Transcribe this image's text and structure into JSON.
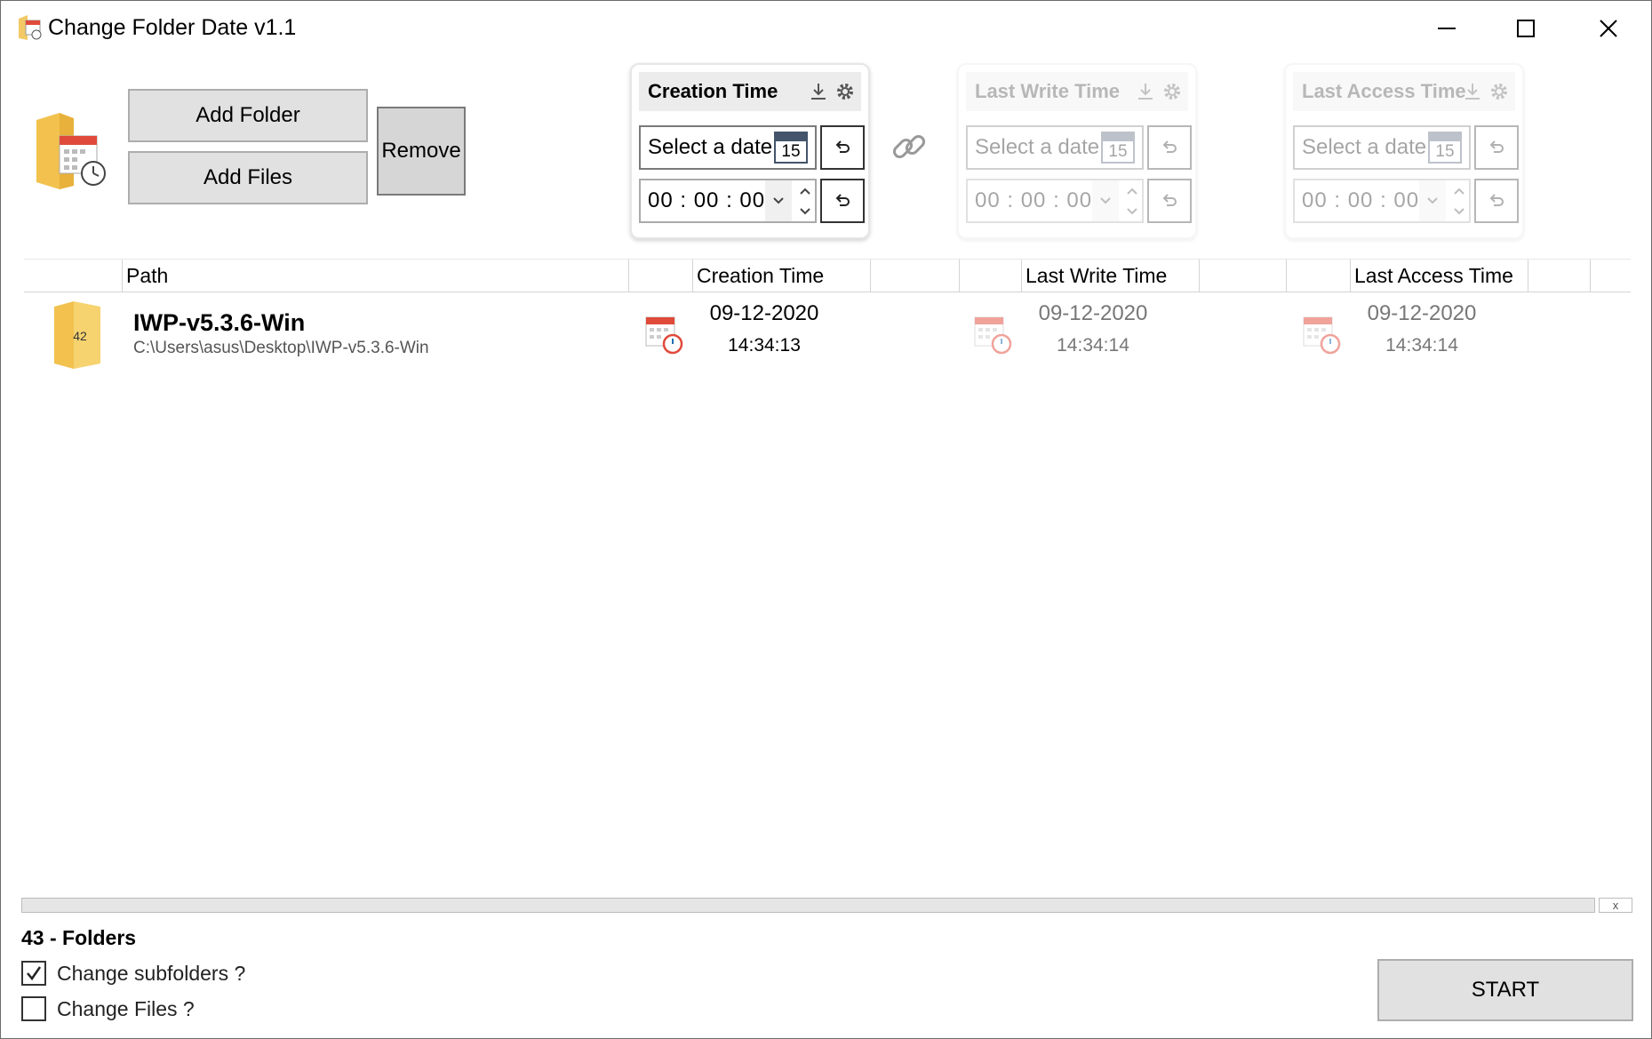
{
  "window": {
    "title": "Change Folder Date v1.1",
    "controls": [
      "minimize",
      "maximize",
      "close"
    ]
  },
  "toolbar": {
    "add_folder": "Add Folder",
    "add_files": "Add Files",
    "remove": "Remove"
  },
  "panels": [
    {
      "title": "Creation Time",
      "date_placeholder": "Select a date",
      "calendar_day": "15",
      "time": "00 : 00 : 00",
      "enabled": true
    },
    {
      "title": "Last Write Time",
      "date_placeholder": "Select a date",
      "calendar_day": "15",
      "time": "00 : 00 : 00",
      "enabled": false
    },
    {
      "title": "Last Access Time",
      "date_placeholder": "Select a date",
      "calendar_day": "15",
      "time": "00 : 00 : 00",
      "enabled": false
    }
  ],
  "table": {
    "columns": [
      "Path",
      "Creation Time",
      "Last Write Time",
      "Last Access Time"
    ],
    "rows": [
      {
        "folder_badge": "42",
        "name": "IWP-v5.3.6-Win",
        "path": "C:\\Users\\asus\\Desktop\\IWP-v5.3.6-Win",
        "creation": {
          "date": "09-12-2020",
          "time": "14:34:13"
        },
        "write": {
          "date": "09-12-2020",
          "time": "14:34:14"
        },
        "access": {
          "date": "09-12-2020",
          "time": "14:34:14"
        }
      }
    ]
  },
  "progress": {
    "value": 0,
    "close_label": "x"
  },
  "footer": {
    "count_label": "43 - Folders",
    "change_subfolders": {
      "label": "Change subfolders ?",
      "checked": true
    },
    "change_files": {
      "label": "Change Files ?",
      "checked": false
    },
    "start": "START"
  }
}
